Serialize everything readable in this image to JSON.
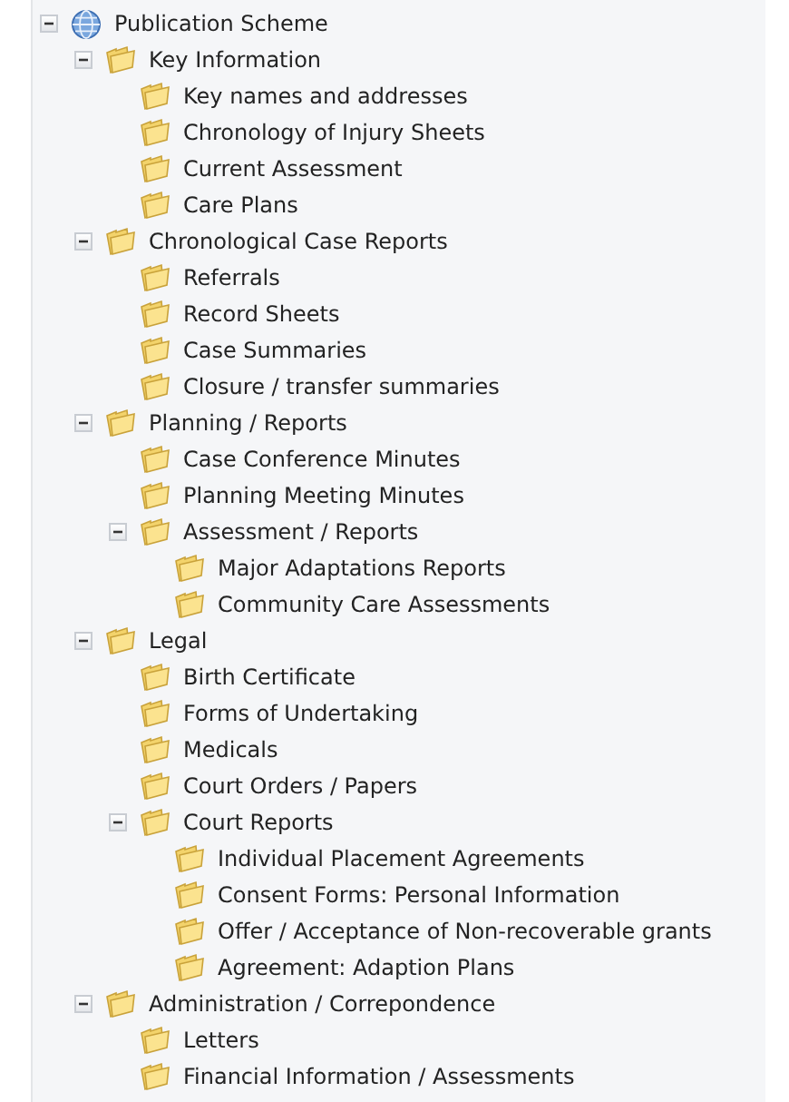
{
  "tree": [
    {
      "label": "Publication Scheme",
      "kind": "globe",
      "expanded": true,
      "children": [
        {
          "label": "Key Information",
          "kind": "folder",
          "expanded": true,
          "children": [
            {
              "label": "Key names and addresses",
              "kind": "folder"
            },
            {
              "label": "Chronology of Injury Sheets",
              "kind": "folder"
            },
            {
              "label": "Current Assessment",
              "kind": "folder"
            },
            {
              "label": "Care Plans",
              "kind": "folder"
            }
          ]
        },
        {
          "label": "Chronological Case Reports",
          "kind": "folder",
          "expanded": true,
          "children": [
            {
              "label": "Referrals",
              "kind": "folder"
            },
            {
              "label": "Record Sheets",
              "kind": "folder"
            },
            {
              "label": "Case Summaries",
              "kind": "folder"
            },
            {
              "label": "Closure / transfer summaries",
              "kind": "folder"
            }
          ]
        },
        {
          "label": "Planning / Reports",
          "kind": "folder",
          "expanded": true,
          "children": [
            {
              "label": "Case Conference Minutes",
              "kind": "folder"
            },
            {
              "label": "Planning Meeting Minutes",
              "kind": "folder"
            },
            {
              "label": "Assessment / Reports",
              "kind": "folder",
              "expanded": true,
              "children": [
                {
                  "label": "Major Adaptations Reports",
                  "kind": "folder"
                },
                {
                  "label": "Community Care Assessments",
                  "kind": "folder"
                }
              ]
            }
          ]
        },
        {
          "label": "Legal",
          "kind": "folder",
          "expanded": true,
          "children": [
            {
              "label": "Birth Certificate",
              "kind": "folder"
            },
            {
              "label": "Forms of Undertaking",
              "kind": "folder"
            },
            {
              "label": "Medicals",
              "kind": "folder"
            },
            {
              "label": "Court Orders / Papers",
              "kind": "folder"
            },
            {
              "label": "Court Reports",
              "kind": "folder",
              "expanded": true,
              "children": [
                {
                  "label": "Individual Placement Agreements",
                  "kind": "folder"
                },
                {
                  "label": "Consent Forms: Personal Information",
                  "kind": "folder"
                },
                {
                  "label": "Offer / Acceptance of Non-recoverable grants",
                  "kind": "folder"
                },
                {
                  "label": "Agreement: Adaption Plans",
                  "kind": "folder"
                }
              ]
            }
          ]
        },
        {
          "label": "Administration / Correpondence",
          "kind": "folder",
          "expanded": true,
          "children": [
            {
              "label": "Letters",
              "kind": "folder"
            },
            {
              "label": "Financial Information / Assessments",
              "kind": "folder"
            }
          ]
        }
      ]
    }
  ]
}
